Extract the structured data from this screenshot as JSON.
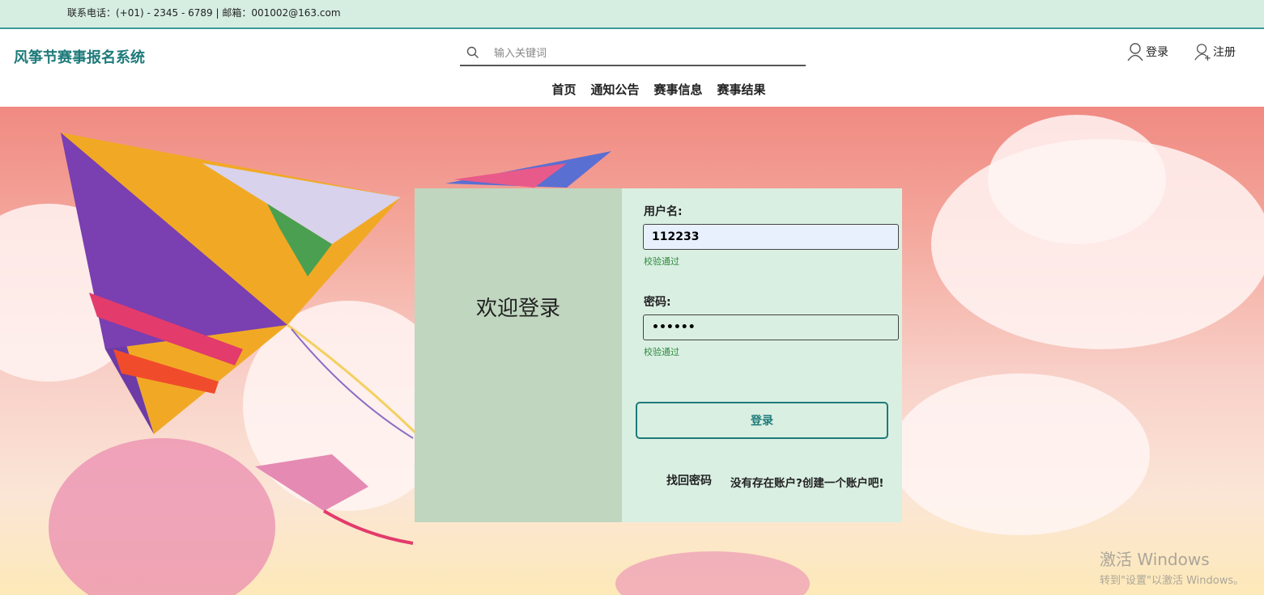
{
  "topbar": {
    "contact": "联系电话：(+01) - 2345 - 6789 | 邮箱：001002@163.com"
  },
  "header": {
    "logo": "风筝节赛事报名系统",
    "search_placeholder": "输入关键词",
    "login_label": "登录",
    "register_label": "注册"
  },
  "nav": {
    "items": [
      "首页",
      "通知公告",
      "赛事信息",
      "赛事结果"
    ]
  },
  "login": {
    "welcome": "欢迎登录",
    "username_label": "用户名:",
    "username_value": "112233",
    "username_hint": "校验通过",
    "password_label": "密码:",
    "password_value": "••••••",
    "password_hint": "校验通过",
    "submit_label": "登录",
    "forgot_label": "找回密码",
    "register_link": "没有存在账户?创建一个账户吧!"
  },
  "watermark": {
    "line1": "激活 Windows",
    "line2": "转到\"设置\"以激活 Windows。"
  },
  "colors": {
    "brand": "#1e7a7a",
    "topbar_bg": "#d6eee2",
    "card_left": "#c0d6bf",
    "card_right": "#d9efe2",
    "hint": "#2e8a3e"
  }
}
